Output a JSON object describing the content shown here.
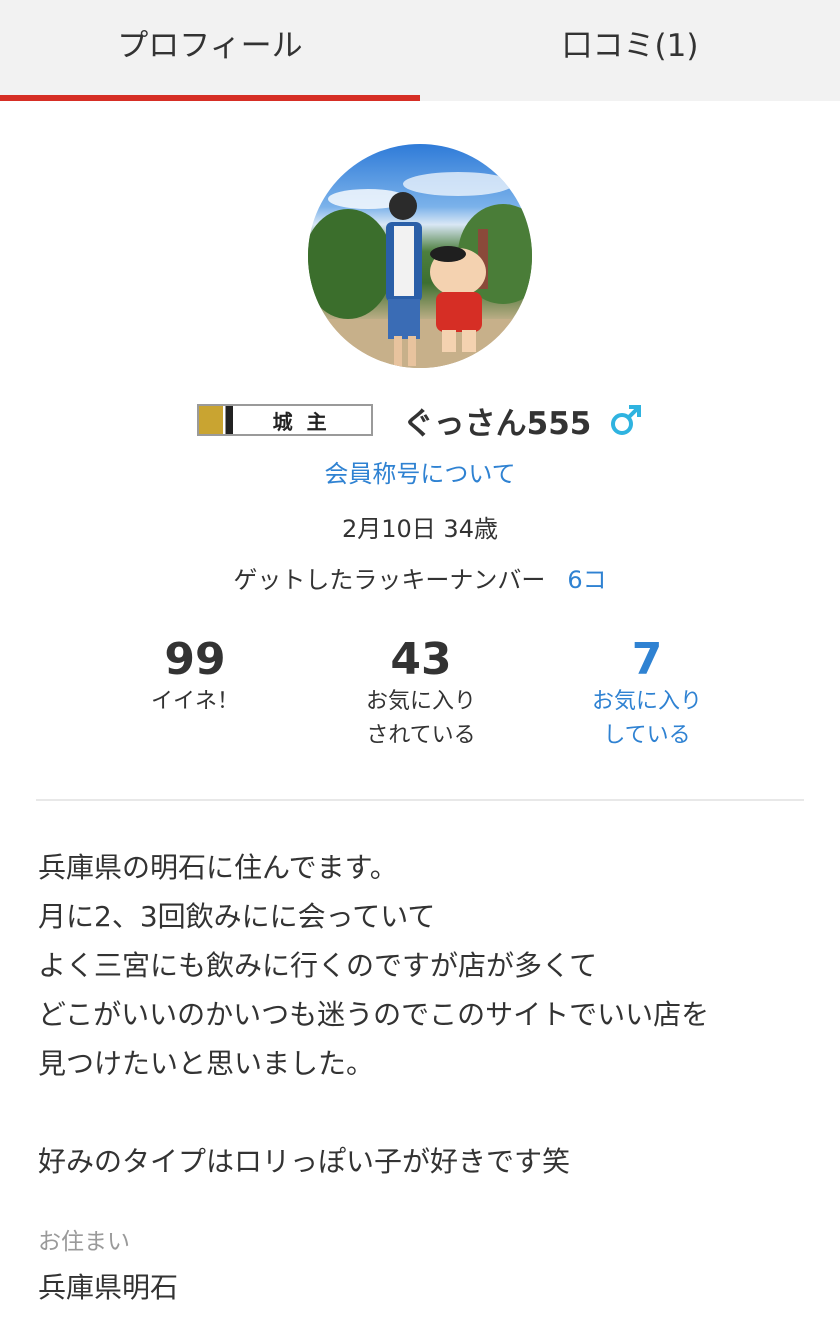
{
  "tabs": [
    {
      "label": "プロフィール",
      "active": true
    },
    {
      "label": "口コミ(1)",
      "active": false
    }
  ],
  "colors": {
    "accent": "#d62e25",
    "link": "#2f82d2",
    "gender_male": "#2fb3e0"
  },
  "profile": {
    "rank_badge": "城主",
    "username": "ぐっさん555",
    "gender_icon": "male-icon",
    "title_link": "会員称号について",
    "birth_age": "2月10日 34歳",
    "lucky_label": "ゲットしたラッキーナンバー",
    "lucky_count": "6コ"
  },
  "stats": [
    {
      "value": "99",
      "line1": "イイネ！",
      "line2": ""
    },
    {
      "value": "43",
      "line1": "お気に入り",
      "line2": "されている"
    },
    {
      "value": "7",
      "line1": "お気に入り",
      "line2": "している"
    }
  ],
  "bio": {
    "lines": [
      "兵庫県の明石に住んでます。",
      "月に2、3回飲みにに会っていて",
      "よく三宮にも飲みに行くのですが店が多くて",
      "どこがいいのかいつも迷うのでこのサイトでいい店を",
      "見つけたいと思いました。",
      "好みのタイプはロリっぽい子が好きです笑"
    ]
  },
  "location": {
    "label": "お住まい",
    "value": "兵庫県明石"
  }
}
